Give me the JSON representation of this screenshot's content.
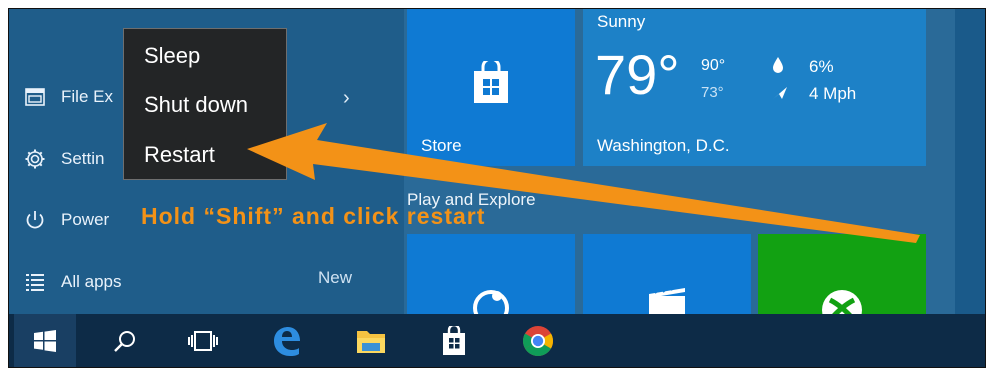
{
  "start_menu": {
    "items": [
      {
        "label": "File Ex",
        "icon": "file-explorer-icon"
      },
      {
        "label": "Settin",
        "icon": "gear-icon"
      },
      {
        "label": "Power",
        "icon": "power-icon"
      },
      {
        "label": "All apps",
        "icon": "list-icon"
      }
    ],
    "chevron": "›",
    "new_label": "New"
  },
  "power_menu": {
    "items": [
      "Sleep",
      "Shut down",
      "Restart"
    ]
  },
  "tiles": {
    "store_label": "Store",
    "group_label": "Play and Explore",
    "weather": {
      "condition": "Sunny",
      "temperature": "79°",
      "high": "90°",
      "low": "73°",
      "precip": "6%",
      "wind": "4 Mph",
      "location": "Washington, D.C."
    }
  },
  "annotation": {
    "text": "Hold “Shift” and click restart",
    "color": "#f39217"
  },
  "taskbar": {
    "icons": [
      "windows-start-icon",
      "search-icon",
      "task-view-icon",
      "edge-icon",
      "file-explorer-icon",
      "store-icon",
      "chrome-icon"
    ]
  },
  "colors": {
    "start_bg": "#1f5d8a",
    "tile_blue": "#0f7ad3",
    "tile_green": "#12a112",
    "taskbar": "#0d2b47"
  }
}
